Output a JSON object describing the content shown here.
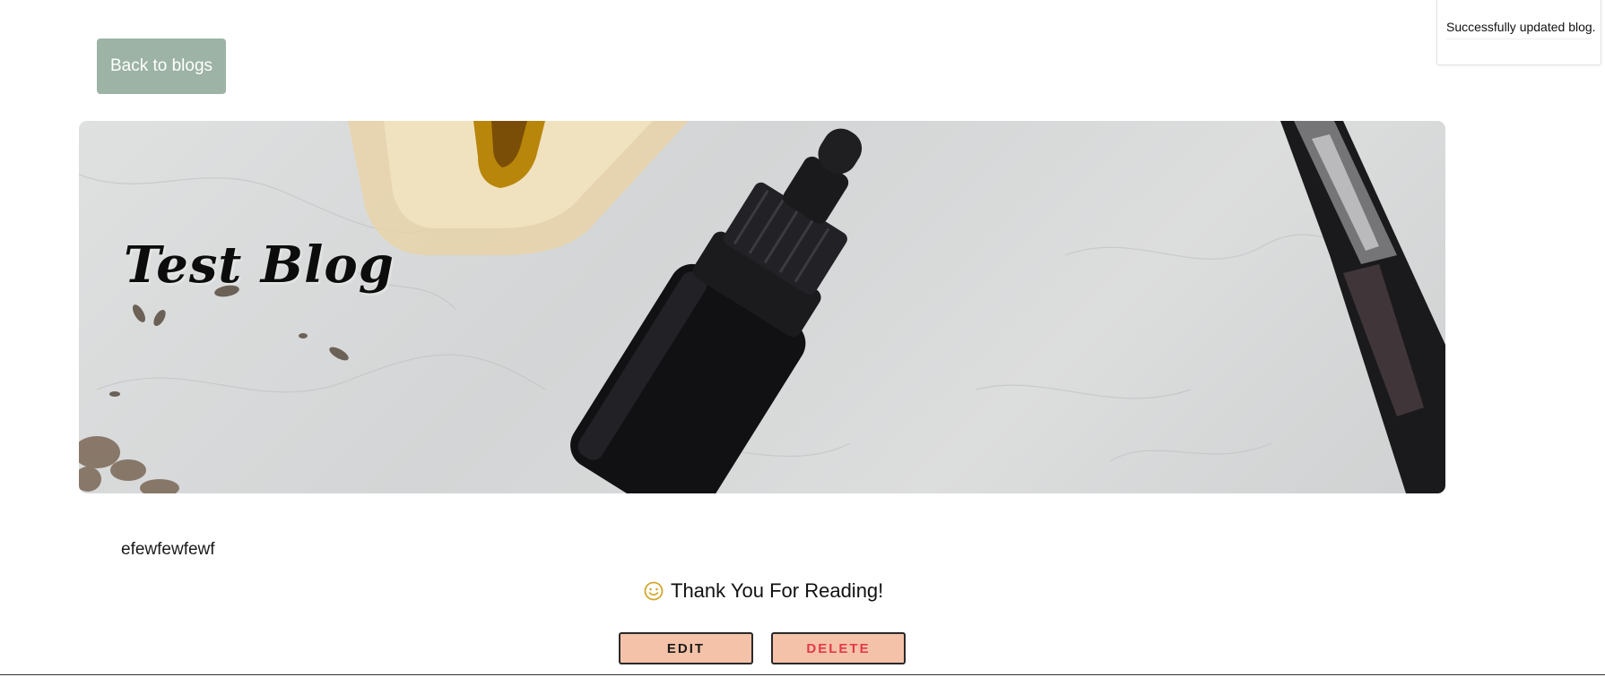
{
  "nav": {
    "back_label": "Back to blogs"
  },
  "toast": {
    "message": "Successfully updated blog."
  },
  "blog": {
    "title": "Test Blog",
    "body": "efewfewfewf",
    "closing": "Thank You For Reading!"
  },
  "actions": {
    "edit_label": "EDIT",
    "delete_label": "DELETE"
  },
  "colors": {
    "back_button_bg": "#9cb3a5",
    "action_button_bg": "#f4c2a8",
    "delete_text": "#e23a4c",
    "smile_icon": "#d4a72c"
  },
  "icons": {
    "closing_icon": "smile-icon"
  }
}
